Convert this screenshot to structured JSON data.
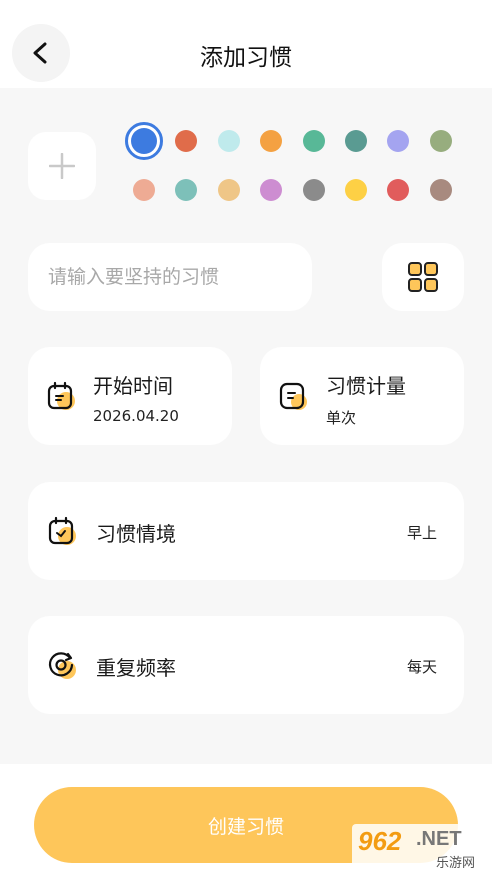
{
  "header": {
    "title": "添加习惯",
    "back_icon": "chevron-left-icon"
  },
  "colors": {
    "selected": "#3d7be0",
    "row1": [
      "#3d7be0",
      "#e06c4a",
      "#bfeaec",
      "#f4a142",
      "#58b897",
      "#5a9b92",
      "#a4a4f0",
      "#97ad7e"
    ],
    "row2": [
      "#eeab94",
      "#7dc0b9",
      "#efc687",
      "#cd8dd1",
      "#8b8b8b",
      "#fdd045",
      "#e15c5c",
      "#a88a7f"
    ]
  },
  "habit_input": {
    "placeholder": "请输入要坚持的习惯",
    "value": ""
  },
  "cards": {
    "start_time": {
      "label": "开始时间",
      "value": "2026.04.20"
    },
    "habit_measure": {
      "label": "习惯计量",
      "value": "单次"
    },
    "habit_context": {
      "label": "习惯情境",
      "value": "早上"
    },
    "repeat_frequency": {
      "label": "重复频率",
      "value": "每天"
    }
  },
  "create_button": {
    "label": "创建习惯",
    "color": "#fec65a"
  },
  "watermark": {
    "num": "962",
    "net": ".NET",
    "cn": "乐游网"
  }
}
